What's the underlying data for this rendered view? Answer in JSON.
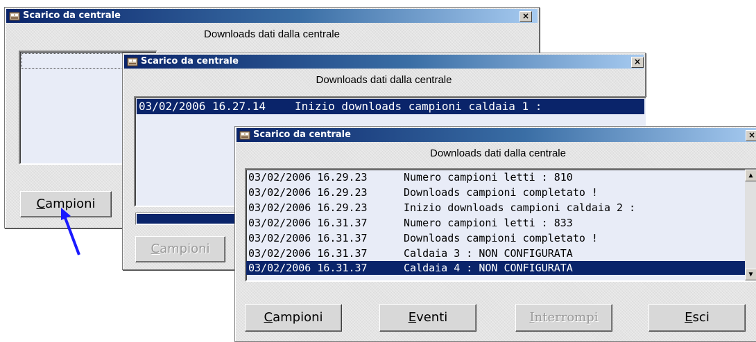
{
  "window1": {
    "title": "Scarico da centrale",
    "subtitle": "Downloads dati dalla centrale",
    "close": "×",
    "campioni_first": "C",
    "campioni_rest": "ampioni"
  },
  "window2": {
    "title": "Scarico da centrale",
    "subtitle": "Downloads dati dalla centrale",
    "close": "×",
    "log": [
      {
        "date": "03/02/2006 16.27.14",
        "msg": "Inizio downloads campioni caldaia 1 :"
      }
    ],
    "campioni_first": "C",
    "campioni_rest": "ampioni"
  },
  "window3": {
    "title": "Scarico da centrale",
    "subtitle": "Downloads dati dalla centrale",
    "close": "×",
    "log": [
      {
        "date": "03/02/2006 16.29.23",
        "msg": "Numero campioni letti : 810"
      },
      {
        "date": "03/02/2006 16.29.23",
        "msg": "Downloads campioni completato !"
      },
      {
        "date": "03/02/2006 16.29.23",
        "msg": "Inizio downloads campioni caldaia 2 :"
      },
      {
        "date": "03/02/2006 16.31.37",
        "msg": "Numero campioni letti : 833"
      },
      {
        "date": "03/02/2006 16.31.37",
        "msg": "Downloads campioni completato !"
      },
      {
        "date": "03/02/2006 16.31.37",
        "msg": "Caldaia 3 : NON CONFIGURATA"
      },
      {
        "date": "03/02/2006 16.31.37",
        "msg": "Caldaia 4 : NON CONFIGURATA"
      }
    ],
    "buttons": {
      "campioni": {
        "first": "C",
        "rest": "ampioni"
      },
      "eventi": {
        "first": "E",
        "rest": "venti"
      },
      "interrompi": {
        "first": "I",
        "rest": "nterrompi"
      },
      "esci": {
        "first": "E",
        "rest": "sci"
      }
    },
    "scroll_up": "▲",
    "scroll_down": "▼"
  },
  "colors": {
    "title_start": "#0a246a",
    "title_end": "#a6caf0",
    "selection": "#0a246a",
    "arrow": "#1a1aff"
  }
}
